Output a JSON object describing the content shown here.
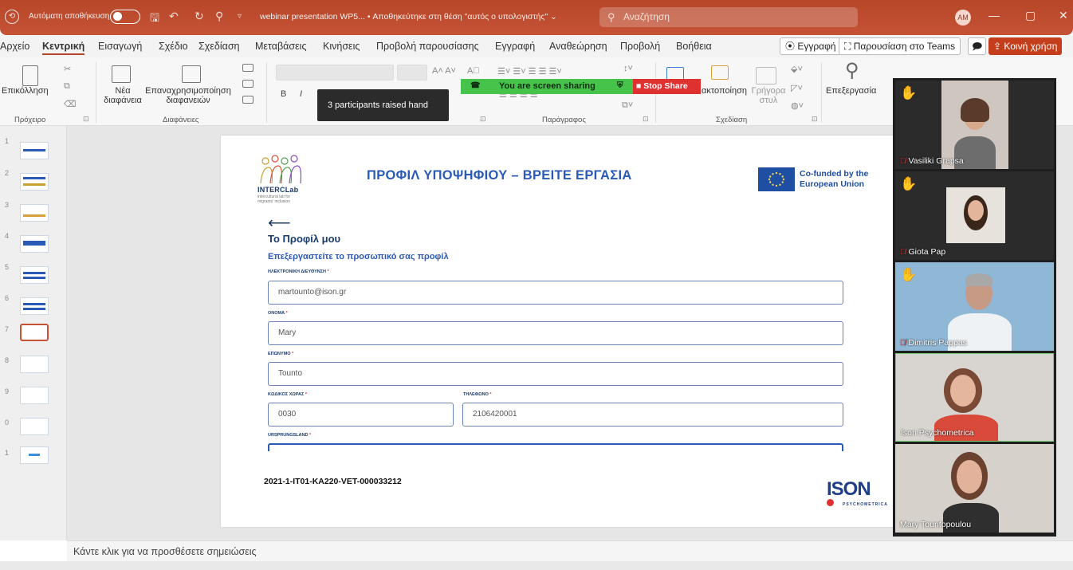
{
  "titlebar": {
    "autosave_label": "Αυτόματη αποθήκευση",
    "doc_title": "webinar presentation WP5...  • Αποθηκεύτηκε στη θέση \"αυτός ο υπολογιστής\" ⌄",
    "search_placeholder": "Αναζήτηση",
    "avatar_initials": "AM",
    "minimize": "—",
    "maximize": "▢",
    "close": "✕"
  },
  "menu": {
    "items": [
      "Αρχείο",
      "Κεντρική",
      "Εισαγωγή",
      "Σχέδιο",
      "Σχεδίαση",
      "Μεταβάσεις",
      "Κινήσεις",
      "Προβολή παρουσίασης",
      "Εγγραφή",
      "Αναθεώρηση",
      "Προβολή",
      "Βοήθεια"
    ],
    "record_btn": "⦿ Εγγραφή",
    "teams_btn": "Παρουσίαση στο Teams",
    "comment_btn": "🗩",
    "share_btn": "Κοινή χρήση"
  },
  "ribbon": {
    "paste": "Επικόλληση",
    "new_slide": "Νέα διαφάνεια",
    "reuse_slides": "Επαναχρησιμοποίηση διαφανειών",
    "group_clipboard": "Πρόχειρο",
    "group_slides": "Διαφάνειες",
    "group_paragraph": "Παράγραφος",
    "group_drawing": "Σχεδίαση",
    "arrange": "ακτοποίηση",
    "quick_styles": "Γρήγορα στυλ",
    "editing": "Επεξεργασία",
    "bold": "B",
    "italic": "I"
  },
  "sharing": {
    "status": "You are screen sharing",
    "stop": "Stop Share",
    "tooltip": "3 participants raised hand"
  },
  "thumbnails": {
    "numbers": [
      "1",
      "2",
      "3",
      "4",
      "5",
      "6",
      "7",
      "8",
      "9",
      "0",
      "1"
    ],
    "selected_index": 6
  },
  "slide": {
    "logo_name": "INTERCLab",
    "logo_tagline": "intercultural lab for migrants' inclusion",
    "title": "ΠΡΟΦΙΛ ΥΠΟΨΗΦΙΟΥ – ΒΡΕΙΤΕ ΕΡΓΑΣΙΑ",
    "eu_text": "Co-funded by the European Union",
    "back": "⟵",
    "profile_heading": "Το Προφίλ μου",
    "profile_sub": "Επεξεργαστείτε το προσωπικό σας προφίλ",
    "fields": {
      "email_label": "ΗΛΕΚΤΡΟΝΙΚΗ ΔΙΕΥΘΥΝΣΗ",
      "email_value": "martounto@ison.gr",
      "name_label": "ΟΝΟΜΑ",
      "name_value": "Mary",
      "surname_label": "ΕΠΩΝΥΜΟ",
      "surname_value": "Tounto",
      "country_code_label": "ΚΩΔΙΚΟΣ ΧΩΡΑΣ",
      "country_code_value": "0030",
      "phone_label": "ΤΗΛΕΦΩΝΟ",
      "phone_value": "2106420001",
      "origin_label": "URSPRUNGSLAND",
      "required_mark": "*"
    },
    "project_code": "2021-1-IT01-KA220-VET-000033212",
    "ison_logo": "ISON",
    "ison_sub": "PSYCHOMETRICA"
  },
  "notes": {
    "placeholder": "Κάντε κλικ για να προσθέσετε σημειώσεις"
  },
  "participants": [
    {
      "name": "Vasiliki Grapsa",
      "raised_hand": true,
      "muted": true
    },
    {
      "name": "Giota Pap",
      "raised_hand": true,
      "muted": true
    },
    {
      "name": "Dimitris Pappas",
      "raised_hand": true,
      "muted": true
    },
    {
      "name": "Ison Psychometrica",
      "raised_hand": false,
      "muted": false
    },
    {
      "name": "Mary Tountopoulou",
      "raised_hand": false,
      "muted": false
    }
  ],
  "colors": {
    "brand": "#b7472a",
    "slide_blue": "#2a5ab8",
    "share_green": "#46c34b",
    "stop_red": "#e03131",
    "hand_yellow": "#f3b729"
  }
}
